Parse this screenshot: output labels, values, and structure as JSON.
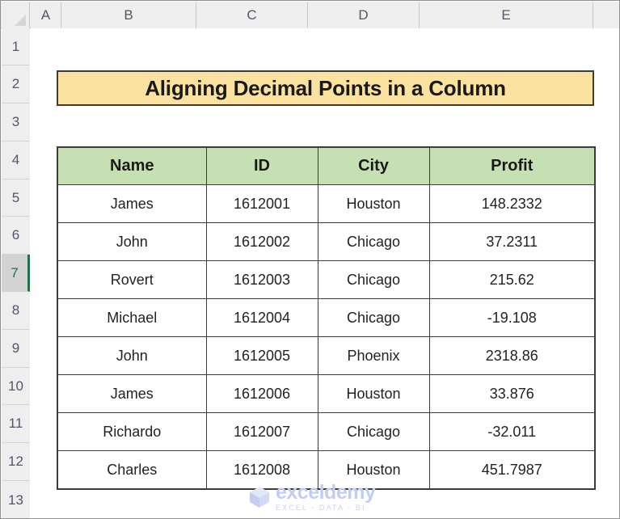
{
  "app": {
    "type": "spreadsheet",
    "select_all_icon": "select-all-triangle-icon"
  },
  "grid": {
    "column_headers": [
      "A",
      "B",
      "C",
      "D",
      "E"
    ],
    "row_headers": [
      "1",
      "2",
      "3",
      "4",
      "5",
      "6",
      "7",
      "8",
      "9",
      "10",
      "11",
      "12",
      "13"
    ],
    "selected_row": "7"
  },
  "title_banner": {
    "text": "Aligning Decimal Points in a Column",
    "fill_color": "#FCE2A0",
    "border_color": "#3B3B3B"
  },
  "table": {
    "header_fill_color": "#C6E0B4",
    "border_color": "#3B3B3B",
    "columns": [
      "Name",
      "ID",
      "City",
      "Profit"
    ],
    "rows": [
      {
        "name": "James",
        "id": "1612001",
        "city": "Houston",
        "profit": "148.2332"
      },
      {
        "name": "John",
        "id": "1612002",
        "city": "Chicago",
        "profit": "37.2311"
      },
      {
        "name": "Rovert",
        "id": "1612003",
        "city": "Chicago",
        "profit": "215.62"
      },
      {
        "name": "Michael",
        "id": "1612004",
        "city": "Chicago",
        "profit": "-19.108"
      },
      {
        "name": "John",
        "id": "1612005",
        "city": "Phoenix",
        "profit": "2318.86"
      },
      {
        "name": "James",
        "id": "1612006",
        "city": "Houston",
        "profit": "33.876"
      },
      {
        "name": "Richardo",
        "id": "1612007",
        "city": "Chicago",
        "profit": "-32.011"
      },
      {
        "name": "Charles",
        "id": "1612008",
        "city": "Houston",
        "profit": "451.7987"
      }
    ]
  },
  "watermark": {
    "name": "exceldemy",
    "tagline": "EXCEL  -  DATA  -  BI",
    "logo_icon": "cube-logo-icon",
    "color": "#C3CDF0"
  }
}
